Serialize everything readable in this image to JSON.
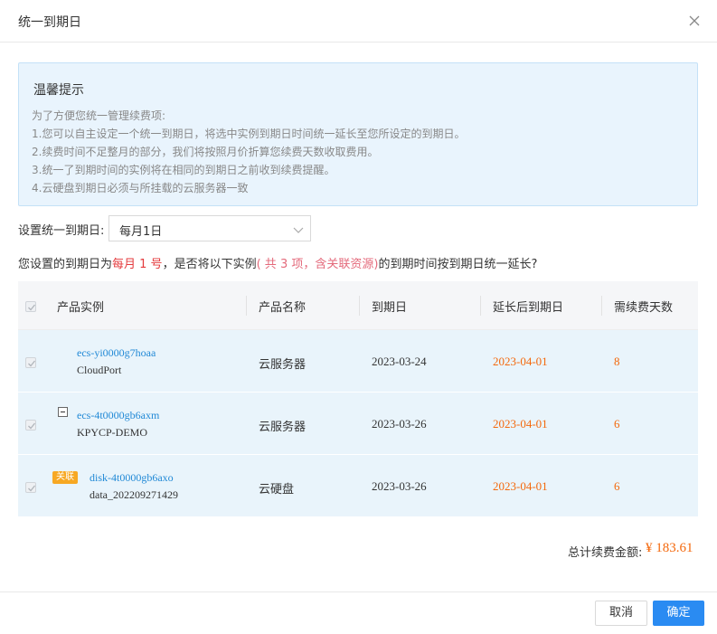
{
  "dialog": {
    "title": "统一到期日"
  },
  "tips": {
    "title": "温馨提示",
    "lines": [
      "为了方便您统一管理续费项:",
      "1.您可以自主设定一个统一到期日，将选中实例到期日时间统一延长至您所设定的到期日。",
      "2.续费时间不足整月的部分，我们将按照月价折算您续费天数收取费用。",
      "3.统一了到期时间的实例将在相同的到期日之前收到续费提醒。",
      "4.云硬盘到期日必须与所挂载的云服务器一致"
    ]
  },
  "setting": {
    "label": "设置统一到期日:",
    "selected": "每月1日"
  },
  "notice": {
    "before": "您设置的到期日为",
    "date": "每月 1 号",
    "middle": "，是否将以下实例",
    "paren_open": "( 共",
    "count": "3",
    "unit": "项，",
    "related": "含关联资源",
    "paren_close": ")",
    "after": "的到期时间按到期日统一延长?"
  },
  "table": {
    "headers": [
      "产品实例",
      "产品名称",
      "到期日",
      "延长后到期日",
      "需续费天数"
    ],
    "rows": [
      {
        "id": "ecs-yi0000g7hoaa",
        "name": "CloudPort",
        "product": "云服务器",
        "expire": "2023-03-24",
        "new_expire": "2023-04-01",
        "days": "8",
        "marker": ""
      },
      {
        "id": "ecs-4t0000gb6axm",
        "name": "KPYCP-DEMO",
        "product": "云服务器",
        "expire": "2023-03-26",
        "new_expire": "2023-04-01",
        "days": "6",
        "marker": "collapse"
      },
      {
        "id": "disk-4t0000gb6axo",
        "name": "data_202209271429",
        "product": "云硬盘",
        "expire": "2023-03-26",
        "new_expire": "2023-04-01",
        "days": "6",
        "marker": "关联"
      }
    ]
  },
  "total": {
    "label": "总计续费金额:",
    "value": "¥ 183.61"
  },
  "buttons": {
    "cancel": "取消",
    "ok": "确定"
  },
  "colors": {
    "primary": "#2a8bf2",
    "link": "#2189d6",
    "orange": "#f4680c",
    "red": "#e4393c",
    "tip_bg": "#e9f4fd",
    "row_bg": "#e9f4fb"
  }
}
